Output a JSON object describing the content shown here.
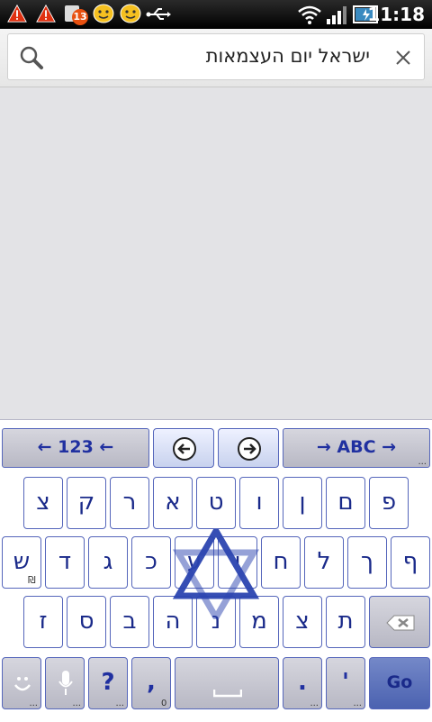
{
  "status_bar": {
    "time": "11:18",
    "badge_count": "13",
    "icons": [
      "warning-icon",
      "warning-icon",
      "notification-badge-icon",
      "smiley-icon",
      "smiley-icon",
      "usb-icon",
      "wifi-icon",
      "signal-icon",
      "battery-icon"
    ]
  },
  "search": {
    "query": "ישראל יום העצמאות",
    "icons": [
      "search-icon",
      "clear-icon"
    ]
  },
  "keyboard": {
    "top_row": {
      "left_label": "← 123 ←",
      "right_label": "→ ABC →"
    },
    "row1": [
      "פ",
      "ם",
      "ן",
      "ו",
      "ט",
      "א",
      "ר",
      "ק",
      "צ"
    ],
    "row2": [
      "ף",
      "ך",
      "ל",
      "ח",
      "י",
      "ע",
      "כ",
      "ג",
      "ד",
      "ש"
    ],
    "row2_sub": "₪",
    "row3": [
      "ת",
      "צ",
      "מ",
      "נ",
      "ה",
      "ב",
      "ס",
      "ז"
    ],
    "bottom": {
      "question": "?",
      "comma": ",",
      "comma_sub": "0",
      "period": ".",
      "apostrophe": "'",
      "go": "Go",
      "more": "..."
    },
    "colors": {
      "key_text": "#1a2a8a",
      "key_border": "#5566bb",
      "go_key": "#4b62b0"
    }
  }
}
